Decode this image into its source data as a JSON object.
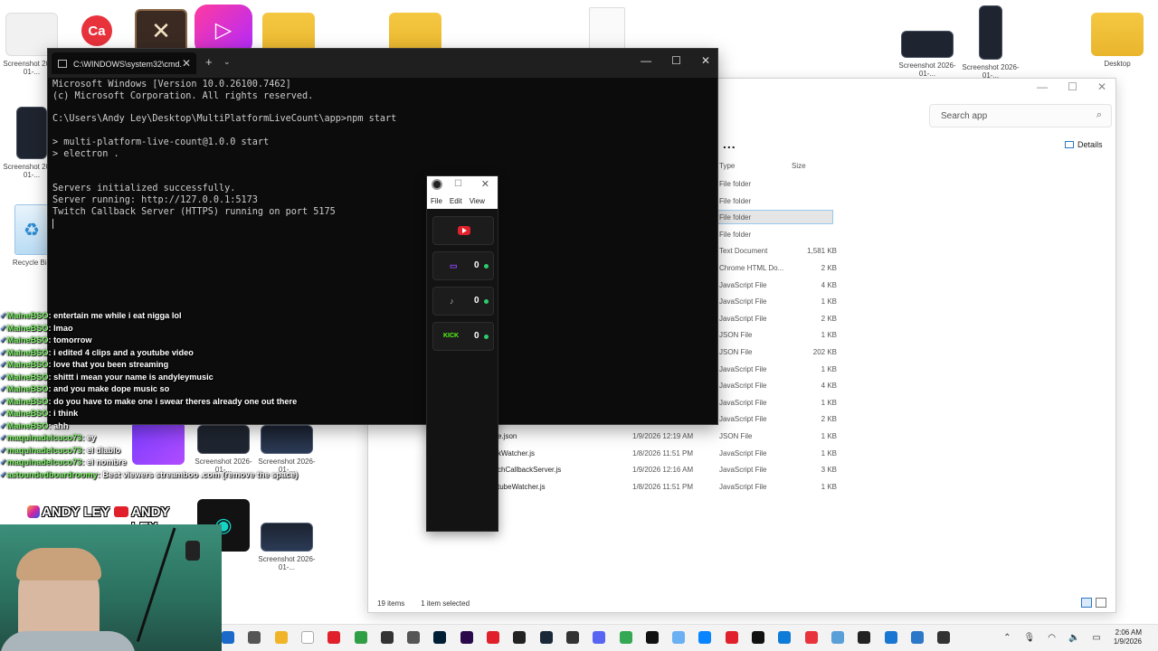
{
  "desktop": {
    "icons": [
      {
        "label": "Screenshot 2026-01-..."
      },
      {
        "label": "Screenshot 2026-01-..."
      },
      {
        "label": "Recycle Bin"
      },
      {
        "label": "Screenshot 2026-01-..."
      },
      {
        "label": "Screenshot 2026-01-..."
      },
      {
        "label": "Desktop"
      },
      {
        "label": "Screenshot 2026-01-..."
      },
      {
        "label": "Screenshot 2026-01-..."
      },
      {
        "label": "Screenshot 2026-01-..."
      }
    ]
  },
  "cmd": {
    "tab_title": "C:\\WINDOWS\\system32\\cmd.",
    "new_tab": "+",
    "lines": [
      "Microsoft Windows [Version 10.0.26100.7462]",
      "(c) Microsoft Corporation. All rights reserved.",
      "",
      "C:\\Users\\Andy Ley\\Desktop\\MultiPlatformLiveCount\\app>npm start",
      "",
      "> multi-platform-live-count@1.0.0 start",
      "> electron .",
      "",
      "",
      "Servers initialized successfully.",
      "Server running: http://127.0.0.1:5173",
      "Twitch Callback Server (HTTPS) running on port 5175"
    ]
  },
  "miniapp": {
    "menu": [
      "File",
      "Edit",
      "View"
    ],
    "tiles": [
      {
        "platform": "youtube",
        "count": ""
      },
      {
        "platform": "twitch",
        "count": "0"
      },
      {
        "platform": "tiktok",
        "count": "0"
      },
      {
        "platform": "kick",
        "label": "KICK",
        "count": "0"
      }
    ]
  },
  "explorer": {
    "search_placeholder": "Search app",
    "more": "...",
    "details_label": "Details",
    "columns": {
      "type": "Type",
      "size": "Size"
    },
    "rows": [
      {
        "name": "",
        "date": "",
        "type": "File folder",
        "size": ""
      },
      {
        "name": "",
        "date": "",
        "type": "File folder",
        "size": ""
      },
      {
        "name": "",
        "date": "",
        "type": "File folder",
        "size": "",
        "selected": true
      },
      {
        "name": "",
        "date": "",
        "type": "File folder",
        "size": ""
      },
      {
        "name": "",
        "date": "",
        "type": "Text Document",
        "size": "1,581 KB"
      },
      {
        "name": "",
        "date": "",
        "type": "Chrome HTML Do...",
        "size": "2 KB"
      },
      {
        "name": "",
        "date": "",
        "type": "JavaScript File",
        "size": "4 KB"
      },
      {
        "name": "",
        "date": "",
        "type": "JavaScript File",
        "size": "1 KB"
      },
      {
        "name": "",
        "date": "",
        "type": "JavaScript File",
        "size": "2 KB"
      },
      {
        "name": "",
        "date": "",
        "type": "JSON File",
        "size": "1 KB"
      },
      {
        "name": "",
        "date": "",
        "type": "JSON File",
        "size": "202 KB"
      },
      {
        "name": "",
        "date": "",
        "type": "JavaScript File",
        "size": "1 KB"
      },
      {
        "name": "",
        "date": "",
        "type": "JavaScript File",
        "size": "4 KB"
      },
      {
        "name": "",
        "date": "",
        "type": "JavaScript File",
        "size": "1 KB"
      },
      {
        "name": "",
        "date": "",
        "type": "JavaScript File",
        "size": "2 KB"
      },
      {
        "name": "e.json",
        "date": "1/9/2026 12:19 AM",
        "type": "JSON File",
        "size": "1 KB"
      },
      {
        "name": "kWatcher.js",
        "date": "1/8/2026 11:51 PM",
        "type": "JavaScript File",
        "size": "1 KB"
      },
      {
        "name": "chCallbackServer.js",
        "date": "1/9/2026 12:16 AM",
        "type": "JavaScript File",
        "size": "3 KB"
      },
      {
        "name": "tubeWatcher.js",
        "date": "1/8/2026 11:51 PM",
        "type": "JavaScript File",
        "size": "1 KB"
      }
    ],
    "status_count": "19 items",
    "status_selected": "1 item selected"
  },
  "chat": [
    {
      "user": "MaineBSO",
      "msg": "entertain me while i eat nigga lol"
    },
    {
      "user": "MaineBSO",
      "msg": "lmao"
    },
    {
      "user": "MaineBSO",
      "msg": "tomorrow"
    },
    {
      "user": "MaineBSO",
      "msg": "i edited 4 clips and a youtube video"
    },
    {
      "user": "MaineBSO",
      "msg": "love that you been streaming"
    },
    {
      "user": "MaineBSO",
      "msg": "shittt i mean your name is andyleymusic"
    },
    {
      "user": "MaineBSO",
      "msg": "and you make dope music so"
    },
    {
      "user": "MaineBSO",
      "msg": "do you have to make one i swear theres already one out there"
    },
    {
      "user": "MaineBSO",
      "msg": "i think"
    },
    {
      "user": "MaineBSO",
      "msg": "ahh"
    },
    {
      "user": "maquinadelcuco73",
      "msg": "ey"
    },
    {
      "user": "maquinadelcuco73",
      "msg": "el diablo"
    },
    {
      "user": "maquinadelcuco73",
      "msg": "el nombre"
    },
    {
      "user": "astoundedboardroomy",
      "msg": "Best viewers streamboo .com (remove the space)"
    }
  ],
  "brand": {
    "name1": "ANDY LEY",
    "name2": "ANDY LEY"
  },
  "tray": {
    "time": "2:06 AM",
    "date": "1/9/2026"
  },
  "colors": {
    "accent": "#2ecc71",
    "chat_user": "#7cf266",
    "youtube": "#e0202a",
    "kick": "#53fc18",
    "twitch": "#9146ff"
  }
}
